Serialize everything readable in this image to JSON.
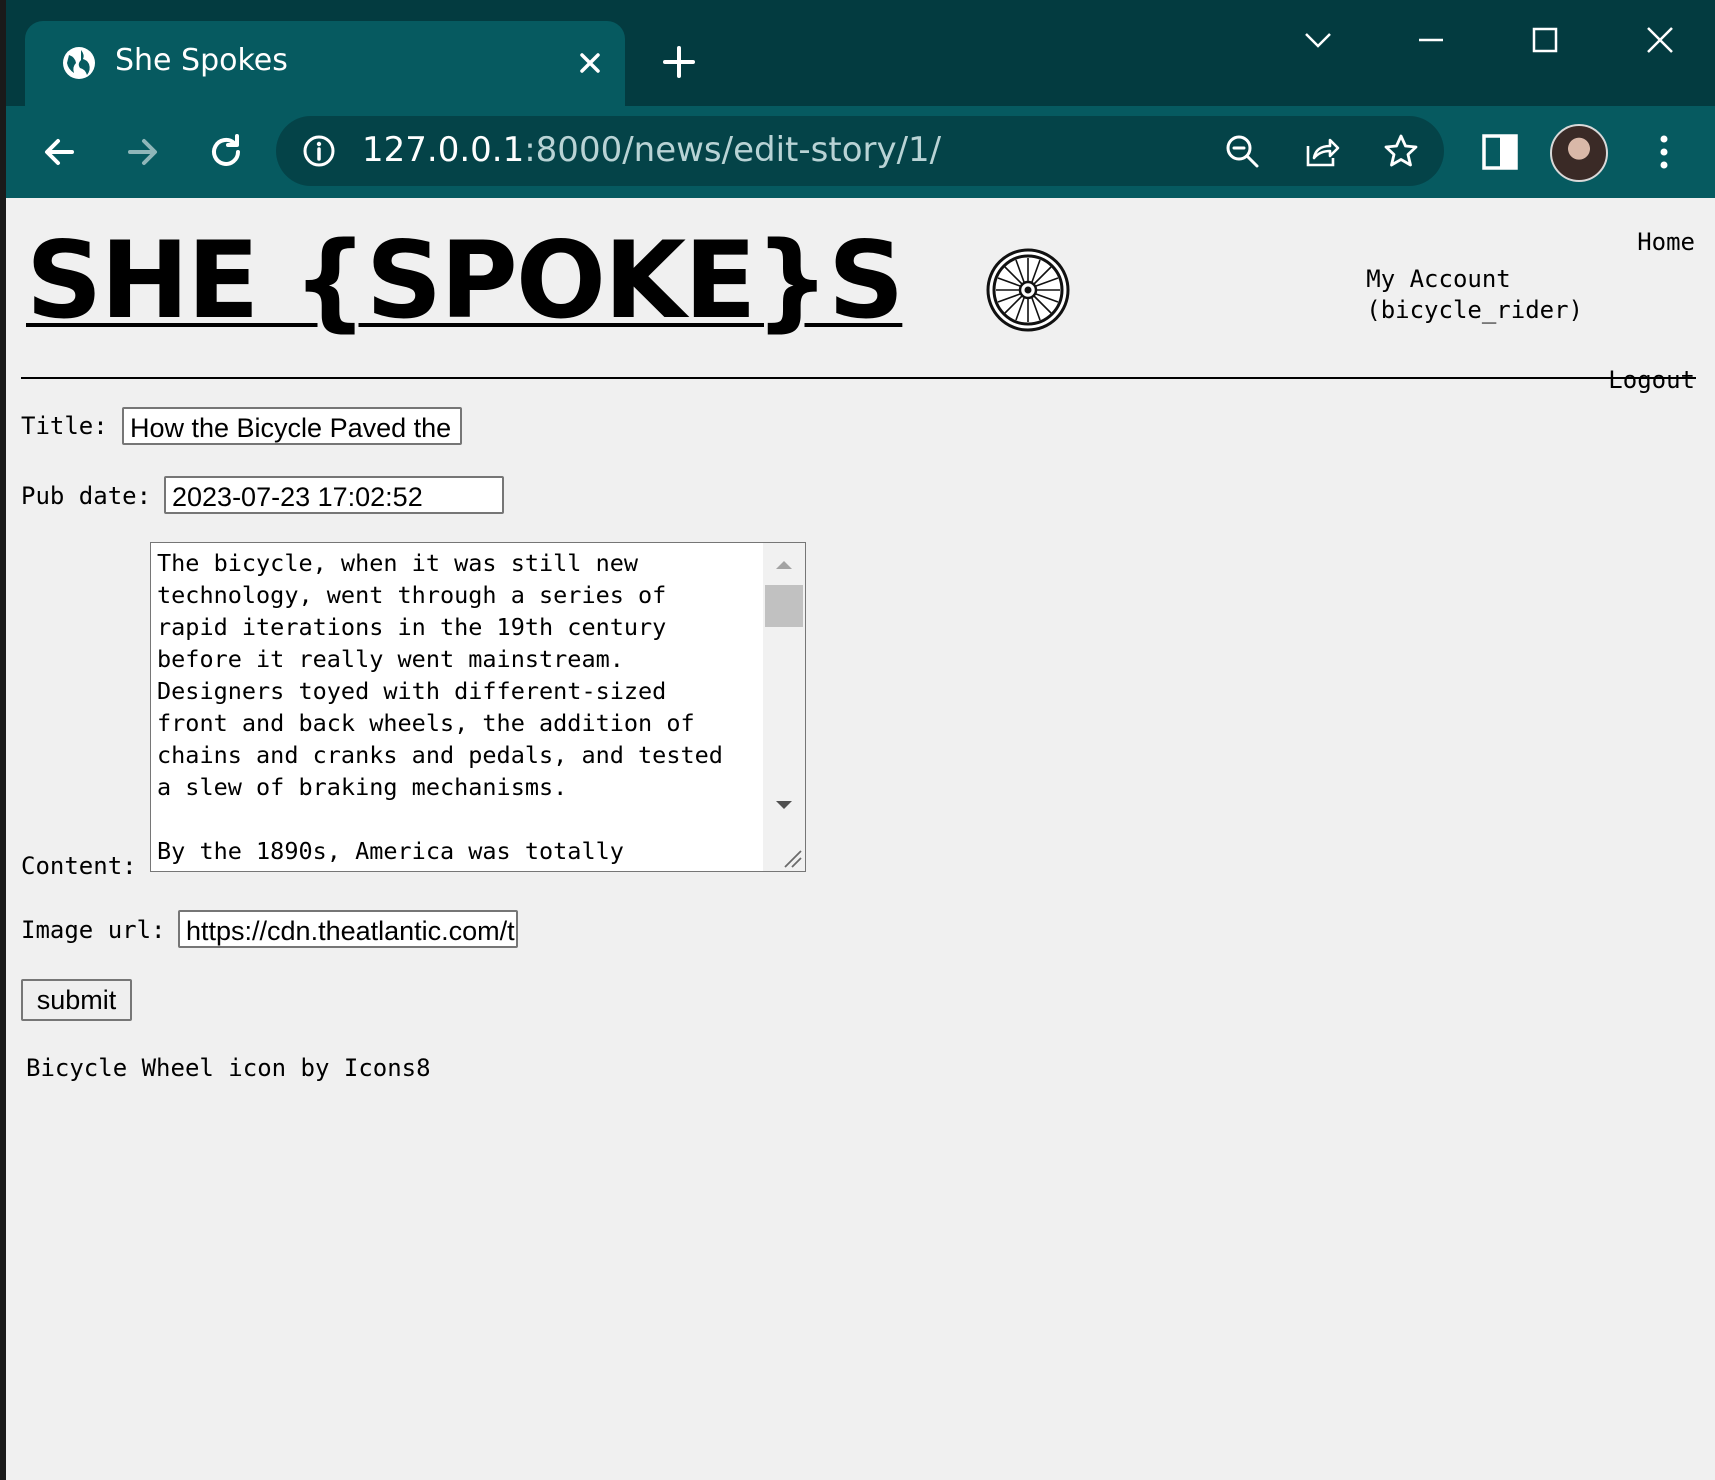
{
  "browser": {
    "tab_title": "She Spokes",
    "url_host": "127.0.0.1",
    "url_path": ":8000/news/edit-story/1/"
  },
  "site": {
    "logo_text": "SHE {SPOKE}S ",
    "nav": {
      "home": "Home",
      "account_line1": "My Account",
      "account_line2": "(bicycle_rider)",
      "logout": "Logout"
    }
  },
  "form": {
    "title_label": "Title:",
    "title_value": "How the Bicycle Paved the",
    "pubdate_label": "Pub date:",
    "pubdate_value": "2023-07-23 17:02:52",
    "content_label": "Content:",
    "content_value": "The bicycle, when it was still new\ntechnology, went through a series of\nrapid iterations in the 19th century\nbefore it really went mainstream.\nDesigners toyed with different-sized\nfront and back wheels, the addition of\nchains and cranks and pedals, and tested\na slew of braking mechanisms.\n\nBy the 1890s, America was totally",
    "image_label": "Image url:",
    "image_value": "https://cdn.theatlantic.com/t",
    "submit_label": "submit"
  },
  "footer": {
    "credit": "Bicycle Wheel icon by  Icons8"
  }
}
